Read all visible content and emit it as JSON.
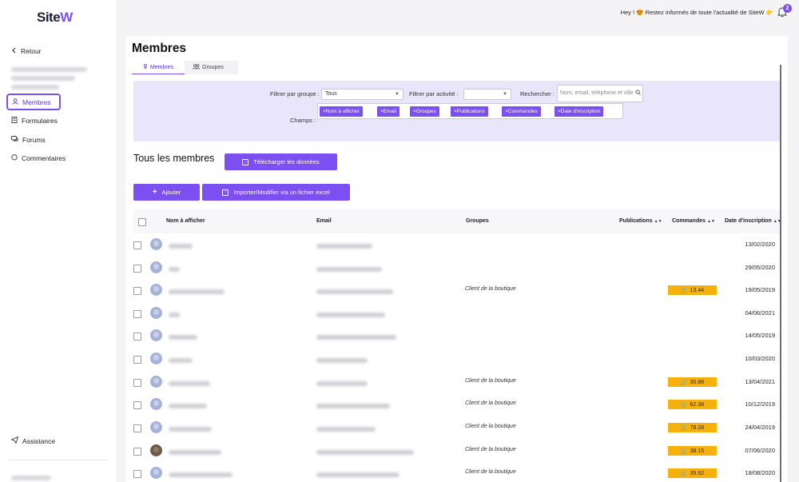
{
  "sidebar": {
    "logo_main": "Site",
    "logo_accent": "W",
    "back_label": "Retour",
    "items": [
      {
        "label": "Membres",
        "icon": "user-icon",
        "active": true
      },
      {
        "label": "Formulaires",
        "icon": "form-icon"
      },
      {
        "label": "Forums",
        "icon": "chat-icon"
      },
      {
        "label": "Commentaires",
        "icon": "comment-icon"
      }
    ],
    "assistance_label": "Assistance"
  },
  "topbar": {
    "message": "Hey ! 😍 Restez informés de toute l'actualité de SiteW 👉",
    "notification_count": "2"
  },
  "page": {
    "title": "Membres",
    "tabs": [
      {
        "label": "Membres",
        "active": true
      },
      {
        "label": "Groupes",
        "active": false
      }
    ]
  },
  "filters": {
    "group_label": "Filtrer par groupe :",
    "group_value": "Tous",
    "activity_label": "Filtrer par activité :",
    "activity_value": "",
    "search_label": "Rechercher :",
    "search_placeholder": "Nom, email, téléphone et ville",
    "fields_label": "Champs :",
    "chips": [
      "×Nom à afficher",
      "×Email",
      "×Groupes",
      "×Publications",
      "×Commandes",
      "×Date d'inscription"
    ]
  },
  "members": {
    "section_title": "Tous les membres",
    "download_label": "Télécharger les données",
    "add_label": "Ajouter",
    "import_label": "Importer/Modifier via un fichier excel"
  },
  "table": {
    "headers": {
      "name": "Nom à afficher",
      "email": "Email",
      "groups": "Groupes",
      "publications": "Publications",
      "orders": "Commandes",
      "date": "Date d'inscription"
    },
    "rows": [
      {
        "group": "",
        "order": "",
        "date": "13/02/2020"
      },
      {
        "group": "",
        "order": "",
        "date": "29/05/2020"
      },
      {
        "group": "Client de la boutique",
        "order": "13.44",
        "date": "19/05/2019"
      },
      {
        "group": "",
        "order": "",
        "date": "04/06/2021"
      },
      {
        "group": "",
        "order": "",
        "date": "14/05/2019"
      },
      {
        "group": "",
        "order": "",
        "date": "10/03/2020"
      },
      {
        "group": "Client de la boutique",
        "order": "30.88",
        "date": "13/04/2021"
      },
      {
        "group": "Client de la boutique",
        "order": "62.38",
        "date": "10/12/2019"
      },
      {
        "group": "Client de la boutique",
        "order": "78.28",
        "date": "24/04/2019"
      },
      {
        "group": "Client de la boutique",
        "order": "38.15",
        "date": "07/06/2020"
      },
      {
        "group": "Client de la boutique",
        "order": "39.92",
        "date": "18/08/2020"
      }
    ]
  },
  "colors": {
    "accent": "#7b4ff0",
    "filter_bg": "#e9e6fb",
    "order_badge": "#f6b10c"
  }
}
